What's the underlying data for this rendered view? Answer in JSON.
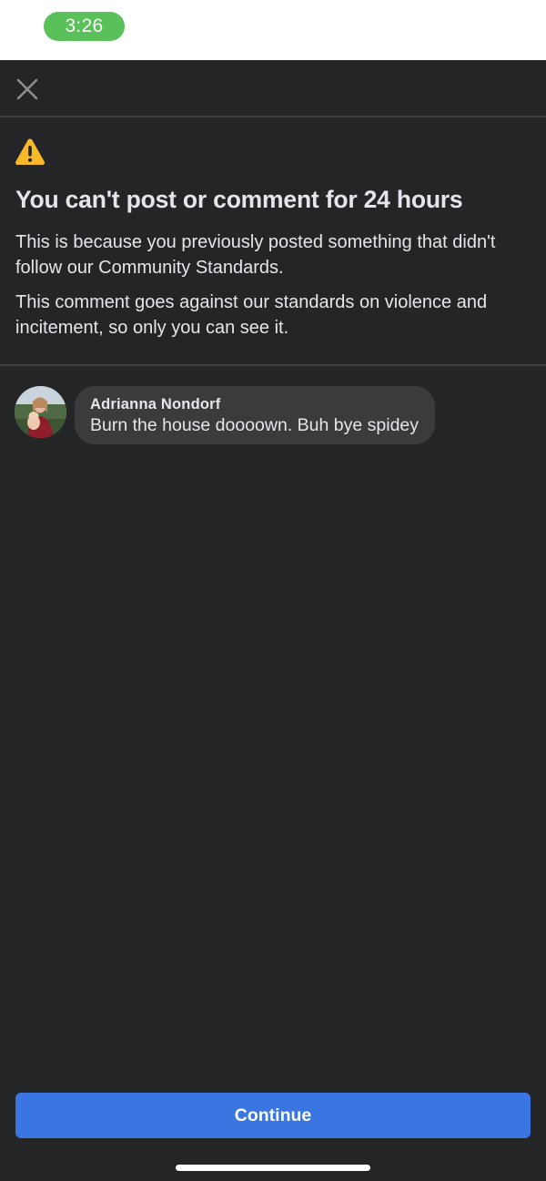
{
  "status_bar": {
    "time": "3:26"
  },
  "header": {
    "close_icon": "close-icon"
  },
  "notice": {
    "icon": "warning-icon",
    "title": "You can't post or comment for 24 hours",
    "paragraph_1": "This is because you previously posted something that didn't follow our Community Standards.",
    "paragraph_2": "This comment goes against our standards on violence and incitement, so only you can see it."
  },
  "comment": {
    "author": "Adrianna Nondorf",
    "text": "Burn the house doooown. Buh bye spidey"
  },
  "footer": {
    "continue_label": "Continue"
  },
  "colors": {
    "background": "#242527",
    "text": "#e4e6eb",
    "bubble": "#3a3b3c",
    "primary_button": "#3a76e2",
    "warning": "#f7b928",
    "time_pill": "#5ac05a"
  }
}
